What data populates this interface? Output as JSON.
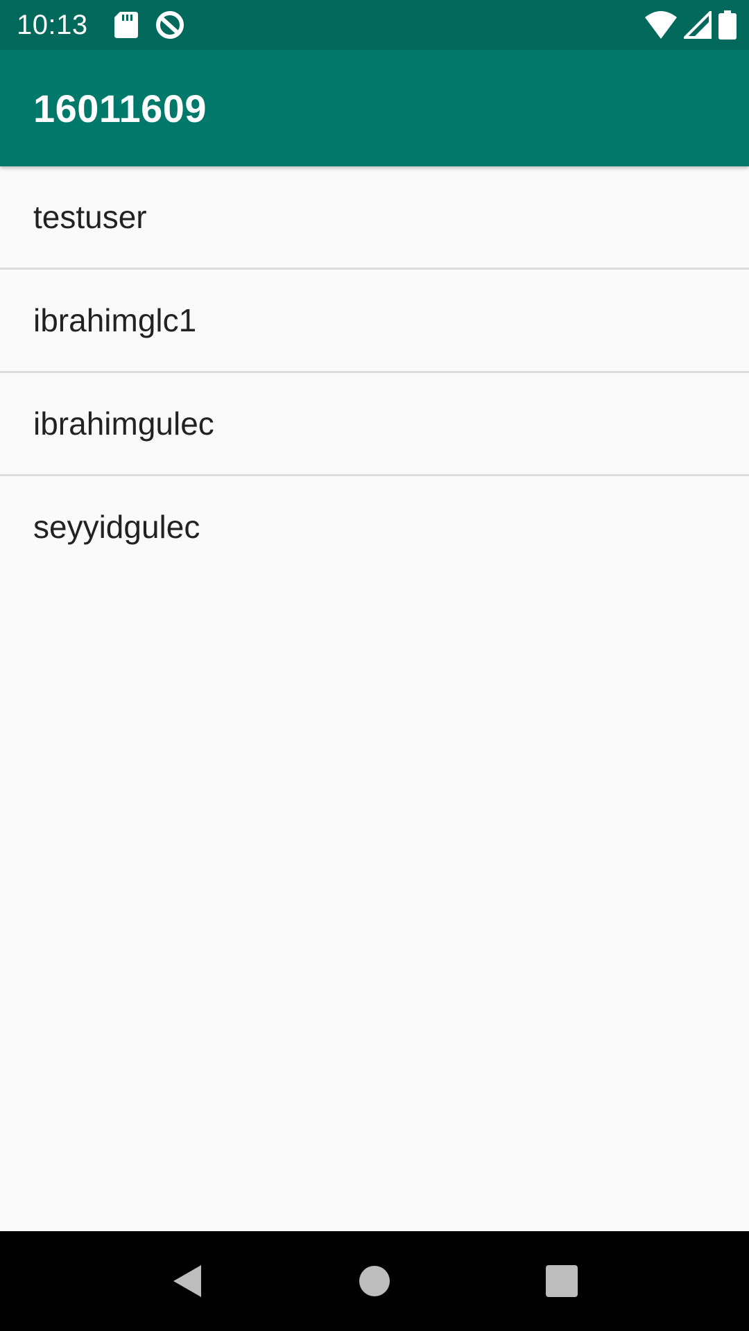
{
  "status_bar": {
    "time": "10:13",
    "icons": [
      "sd-card-icon",
      "sync-icon",
      "wifi-icon",
      "signal-icon",
      "battery-icon"
    ]
  },
  "app_bar": {
    "title": "16011609",
    "color": "#00796b"
  },
  "list": {
    "items": [
      {
        "label": "testuser"
      },
      {
        "label": "ibrahimglc1"
      },
      {
        "label": "ibrahimgulec"
      },
      {
        "label": "seyyidgulec"
      }
    ]
  },
  "nav_bar": {
    "buttons": [
      "back-icon",
      "home-icon",
      "recents-icon"
    ]
  },
  "colors": {
    "status_bar": "#00695c",
    "app_bar": "#00796b",
    "background": "#fafafa"
  }
}
